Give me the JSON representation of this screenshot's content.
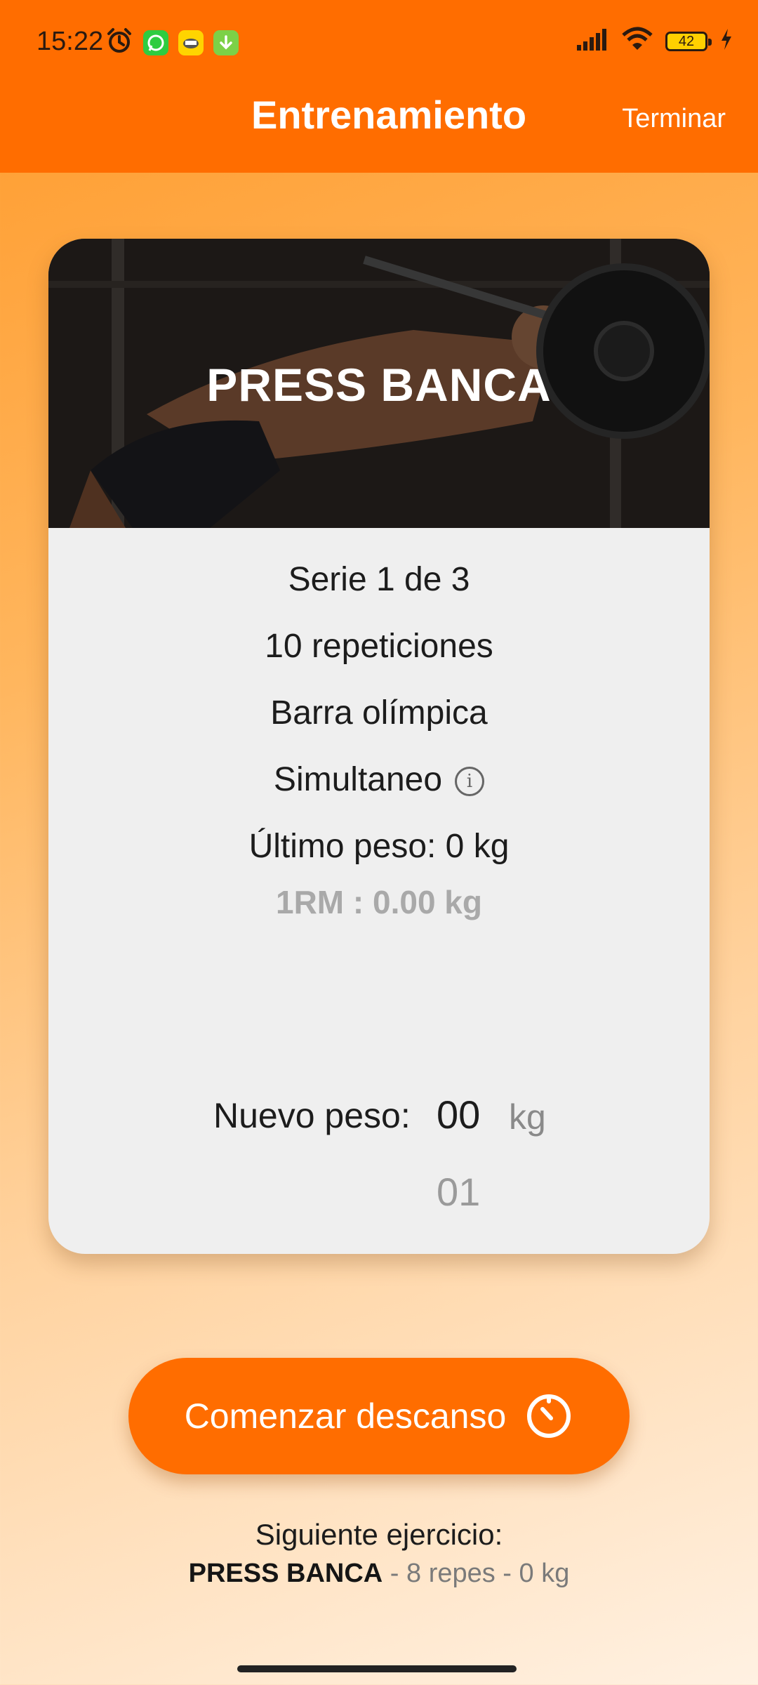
{
  "status_bar": {
    "time": "15:22",
    "battery": "42",
    "icons": [
      "alarm-icon",
      "whatsapp-icon",
      "app-icon",
      "download-icon",
      "signal-icon",
      "wifi-icon",
      "battery-icon",
      "charging-icon"
    ]
  },
  "header": {
    "title": "Entrenamiento",
    "action": "Terminar"
  },
  "exercise_card": {
    "title": "PRESS BANCA",
    "set": "Serie 1 de 3",
    "reps": "10 repeticiones",
    "equipment": "Barra olímpica",
    "mode": "Simultaneo",
    "info_icon": "info-icon",
    "last_weight": "Último peso: 0 kg",
    "one_rm": "1RM : 0.00 kg",
    "new_weight": {
      "label": "Nuevo peso:",
      "value": "00",
      "next_value": "01",
      "unit": "kg"
    }
  },
  "rest_button": {
    "label": "Comenzar descanso",
    "icon": "timer-icon"
  },
  "next_exercise": {
    "title": "Siguiente ejercicio:",
    "name": "PRESS BANCA",
    "details": " - 8 repes - 0 kg"
  },
  "colors": {
    "accent": "#ff6d00",
    "card": "#efefef"
  }
}
